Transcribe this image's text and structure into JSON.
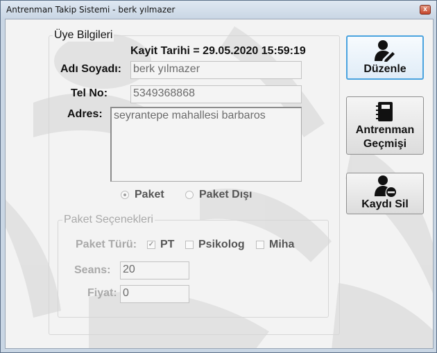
{
  "window": {
    "title": "Antrenman Takip Sistemi - berk yılmazer",
    "close_glyph": "x"
  },
  "member": {
    "group_title": "Üye Bilgileri",
    "kayit_tarihi": "Kayit Tarihi = 29.05.2020 15:59:19",
    "name_label": "Adı Soyadı:",
    "name_value": "berk yılmazer",
    "phone_label": "Tel No:",
    "phone_value": "5349368868",
    "address_label": "Adres:",
    "address_value": "seyrantepe mahallesi barbaros",
    "radio_paket": "Paket",
    "radio_paket_disi": "Paket Dışı",
    "radio_selected": "Paket"
  },
  "package": {
    "group_title": "Paket Seçenekleri",
    "type_label": "Paket Türü:",
    "options": [
      {
        "label": "PT",
        "checked": true
      },
      {
        "label": "Psikolog",
        "checked": false
      },
      {
        "label": "Miha",
        "checked": false
      }
    ],
    "sessions_label": "Seans:",
    "sessions_value": "20",
    "price_label": "Fiyat:",
    "price_value": "0"
  },
  "actions": {
    "edit_label": "Düzenle",
    "history_label": "Antrenman\nGeçmişi",
    "delete_label": "Kaydı Sil"
  },
  "icons": {
    "edit": "user-edit-icon",
    "history": "notebook-icon",
    "delete": "user-remove-icon"
  }
}
